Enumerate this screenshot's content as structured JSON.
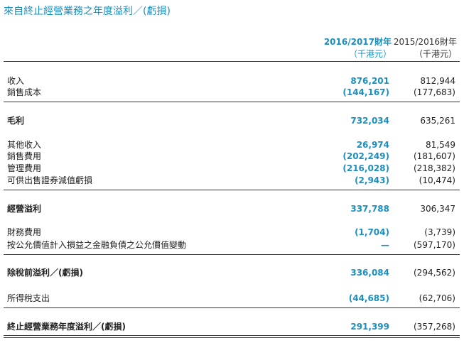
{
  "title": "來自終止經營業務之年度溢利／(虧損)",
  "headers": {
    "current_year": "2016/2017財年",
    "current_unit": "（千港元）",
    "prior_year": "2015/2016財年",
    "prior_unit": "（千港元）"
  },
  "rows": [
    {
      "label": "收入",
      "current": "876,201",
      "prior": "812,944"
    },
    {
      "label": "銷售成本",
      "current": "(144,167)",
      "prior": "(177,683)"
    },
    {
      "label": "毛利",
      "current": "732,034",
      "prior": "635,261"
    },
    {
      "label": "其他收入",
      "current": "26,974",
      "prior": "81,549"
    },
    {
      "label": "銷售費用",
      "current": "(202,249)",
      "prior": "(181,607)"
    },
    {
      "label": "管理費用",
      "current": "(216,028)",
      "prior": "(218,382)"
    },
    {
      "label": "可供出售證券減值虧損",
      "current": "(2,943)",
      "prior": "(10,474)"
    },
    {
      "label": "經營溢利",
      "current": "337,788",
      "prior": "306,347"
    },
    {
      "label": "財務費用",
      "current": "(1,704)",
      "prior": "(3,739)"
    },
    {
      "label": "按公允價值計入損益之金融負債之公允價值變動",
      "current": "—",
      "prior": "(597,170)"
    },
    {
      "label": "除稅前溢利／(虧損)",
      "current": "336,084",
      "prior": "(294,562)"
    },
    {
      "label": "所得稅支出",
      "current": "(44,685)",
      "prior": "(62,706)"
    },
    {
      "label": "終止經營業務年度溢利／(虧損)",
      "current": "291,399",
      "prior": "(357,268)"
    }
  ]
}
